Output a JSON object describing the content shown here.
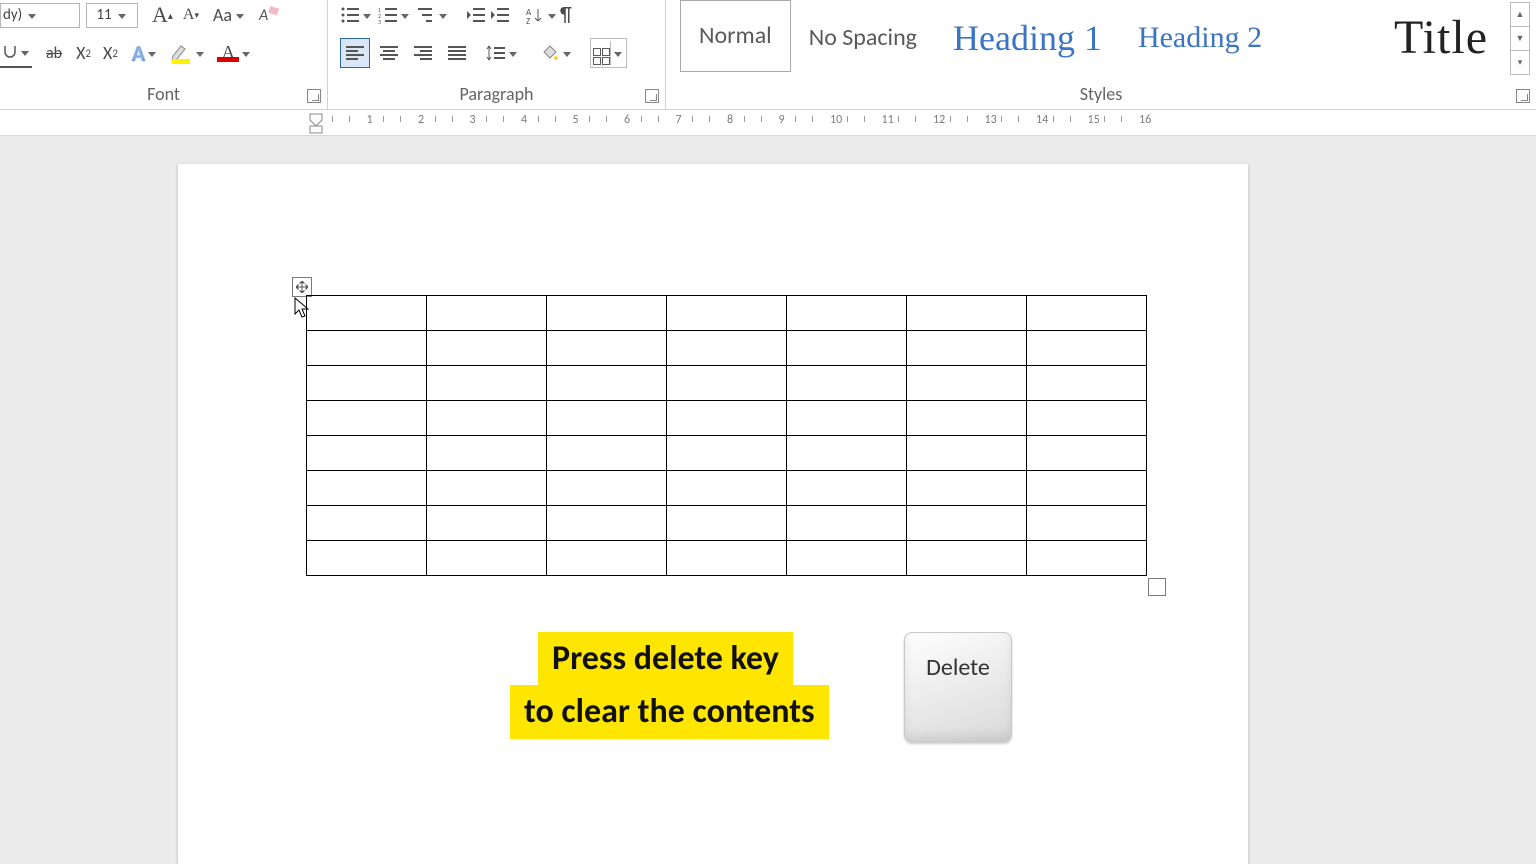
{
  "ribbon": {
    "groups": {
      "font": {
        "label": "Font"
      },
      "paragraph": {
        "label": "Paragraph"
      },
      "styles": {
        "label": "Styles"
      }
    },
    "font_name_suffix": "dy)",
    "font_size": "11"
  },
  "styles_gallery": {
    "normal": "Normal",
    "no_spacing": "No Spacing",
    "heading1": "Heading 1",
    "heading2": "Heading 2",
    "title": "Title"
  },
  "ruler": {
    "marks": [
      "1",
      "2",
      "3",
      "4",
      "5",
      "6",
      "7",
      "8",
      "9",
      "10",
      "11",
      "12",
      "13",
      "14",
      "15",
      "16"
    ]
  },
  "document": {
    "table": {
      "rows": 8,
      "cols": 7
    }
  },
  "callout": {
    "line1": "Press delete key",
    "line2": "to clear the contents"
  },
  "key": {
    "label": "Delete"
  }
}
